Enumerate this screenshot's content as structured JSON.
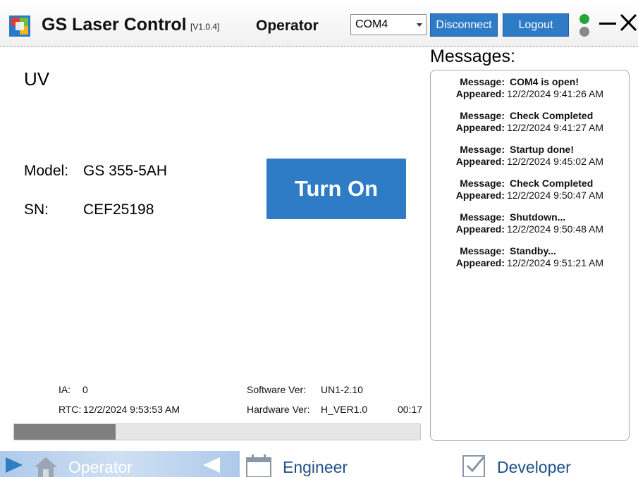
{
  "header": {
    "app_title": "GS Laser Control",
    "version": "[V1.0.4]",
    "role": "Operator",
    "port_value": "COM4",
    "disconnect_label": "Disconnect",
    "logout_label": "Logout",
    "status_colors": {
      "top": "#22a83a",
      "bottom": "#888888"
    }
  },
  "laser": {
    "channel": "UV",
    "model_label": "Model:",
    "model_value": "GS 355-5AH",
    "sn_label": "SN:",
    "sn_value": "CEF25198",
    "turn_on_label": "Turn On"
  },
  "status": {
    "ia_label": "IA:",
    "ia_value": "0",
    "rtc_label": "RTC:",
    "rtc_value": "12/2/2024 9:53:53 AM",
    "software_label": "Software Ver:",
    "software_value": "UN1-2.10",
    "hardware_label": "Hardware Ver:",
    "hardware_value": "H_VER1.0",
    "timer": "00:17",
    "progress_percent": 25
  },
  "messages": {
    "title": "Messages:",
    "message_label": "Message:",
    "appeared_label": "Appeared:",
    "items": [
      {
        "text": "COM4 is open!",
        "time": "12/2/2024 9:41:26 AM"
      },
      {
        "text": "Check Completed",
        "time": "12/2/2024 9:41:27 AM"
      },
      {
        "text": "Startup done!",
        "time": "12/2/2024 9:45:02 AM"
      },
      {
        "text": "Check Completed",
        "time": "12/2/2024 9:50:47 AM"
      },
      {
        "text": "Shutdown...",
        "time": "12/2/2024 9:50:48 AM"
      },
      {
        "text": "Standby...",
        "time": "12/2/2024 9:51:21 AM"
      }
    ]
  },
  "nav": {
    "operator": "Operator",
    "engineer": "Engineer",
    "developer": "Developer",
    "active": "operator"
  },
  "colors": {
    "accent": "#2e7bc6",
    "nav_active": "#aec9ea"
  }
}
